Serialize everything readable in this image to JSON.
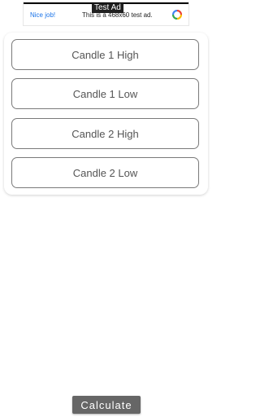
{
  "ad": {
    "tag": "Test Ad",
    "headline": "Nice job!",
    "body": "This is a 468x60 test ad.",
    "logo_icon": "ad-choices-logo-icon"
  },
  "form": {
    "fields": [
      {
        "placeholder": "Candle 1 High"
      },
      {
        "placeholder": "Candle 1 Low"
      },
      {
        "placeholder": "Candle 2 High"
      },
      {
        "placeholder": "Candle 2 Low"
      }
    ]
  },
  "actions": {
    "calculate_label": "Calculate"
  },
  "colors": {
    "ad_link": "#1a73e8",
    "field_border": "#7a7a7a",
    "button_bg": "#666666"
  }
}
